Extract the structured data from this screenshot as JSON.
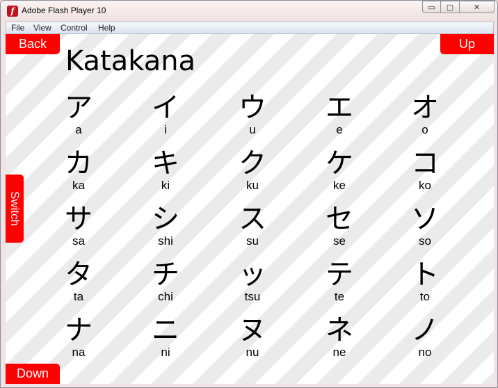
{
  "window": {
    "title": "Adobe Flash Player 10",
    "min_glyph": "▭",
    "max_glyph": "▢",
    "close_glyph": "✕"
  },
  "menu": [
    "File",
    "View",
    "Control",
    "Help"
  ],
  "nav": {
    "back": "Back",
    "up": "Up",
    "down": "Down",
    "switch": "Switch"
  },
  "page_title": "Katakana",
  "rows": [
    [
      {
        "kana": "ア",
        "romaji": "a"
      },
      {
        "kana": "イ",
        "romaji": "i"
      },
      {
        "kana": "ウ",
        "romaji": "u"
      },
      {
        "kana": "エ",
        "romaji": "e"
      },
      {
        "kana": "オ",
        "romaji": "o"
      }
    ],
    [
      {
        "kana": "カ",
        "romaji": "ka"
      },
      {
        "kana": "キ",
        "romaji": "ki"
      },
      {
        "kana": "ク",
        "romaji": "ku"
      },
      {
        "kana": "ケ",
        "romaji": "ke"
      },
      {
        "kana": "コ",
        "romaji": "ko"
      }
    ],
    [
      {
        "kana": "サ",
        "romaji": "sa"
      },
      {
        "kana": "シ",
        "romaji": "shi"
      },
      {
        "kana": "ス",
        "romaji": "su"
      },
      {
        "kana": "セ",
        "romaji": "se"
      },
      {
        "kana": "ソ",
        "romaji": "so"
      }
    ],
    [
      {
        "kana": "タ",
        "romaji": "ta"
      },
      {
        "kana": "チ",
        "romaji": "chi"
      },
      {
        "kana": "ッ",
        "romaji": "tsu"
      },
      {
        "kana": "テ",
        "romaji": "te"
      },
      {
        "kana": "ト",
        "romaji": "to"
      }
    ],
    [
      {
        "kana": "ナ",
        "romaji": "na"
      },
      {
        "kana": "ニ",
        "romaji": "ni"
      },
      {
        "kana": "ヌ",
        "romaji": "nu"
      },
      {
        "kana": "ネ",
        "romaji": "ne"
      },
      {
        "kana": "ノ",
        "romaji": "no"
      }
    ]
  ],
  "colors": {
    "button": "#ff0000",
    "stripe_dark": "#ebebeb",
    "stripe_light": "#ffffff"
  }
}
